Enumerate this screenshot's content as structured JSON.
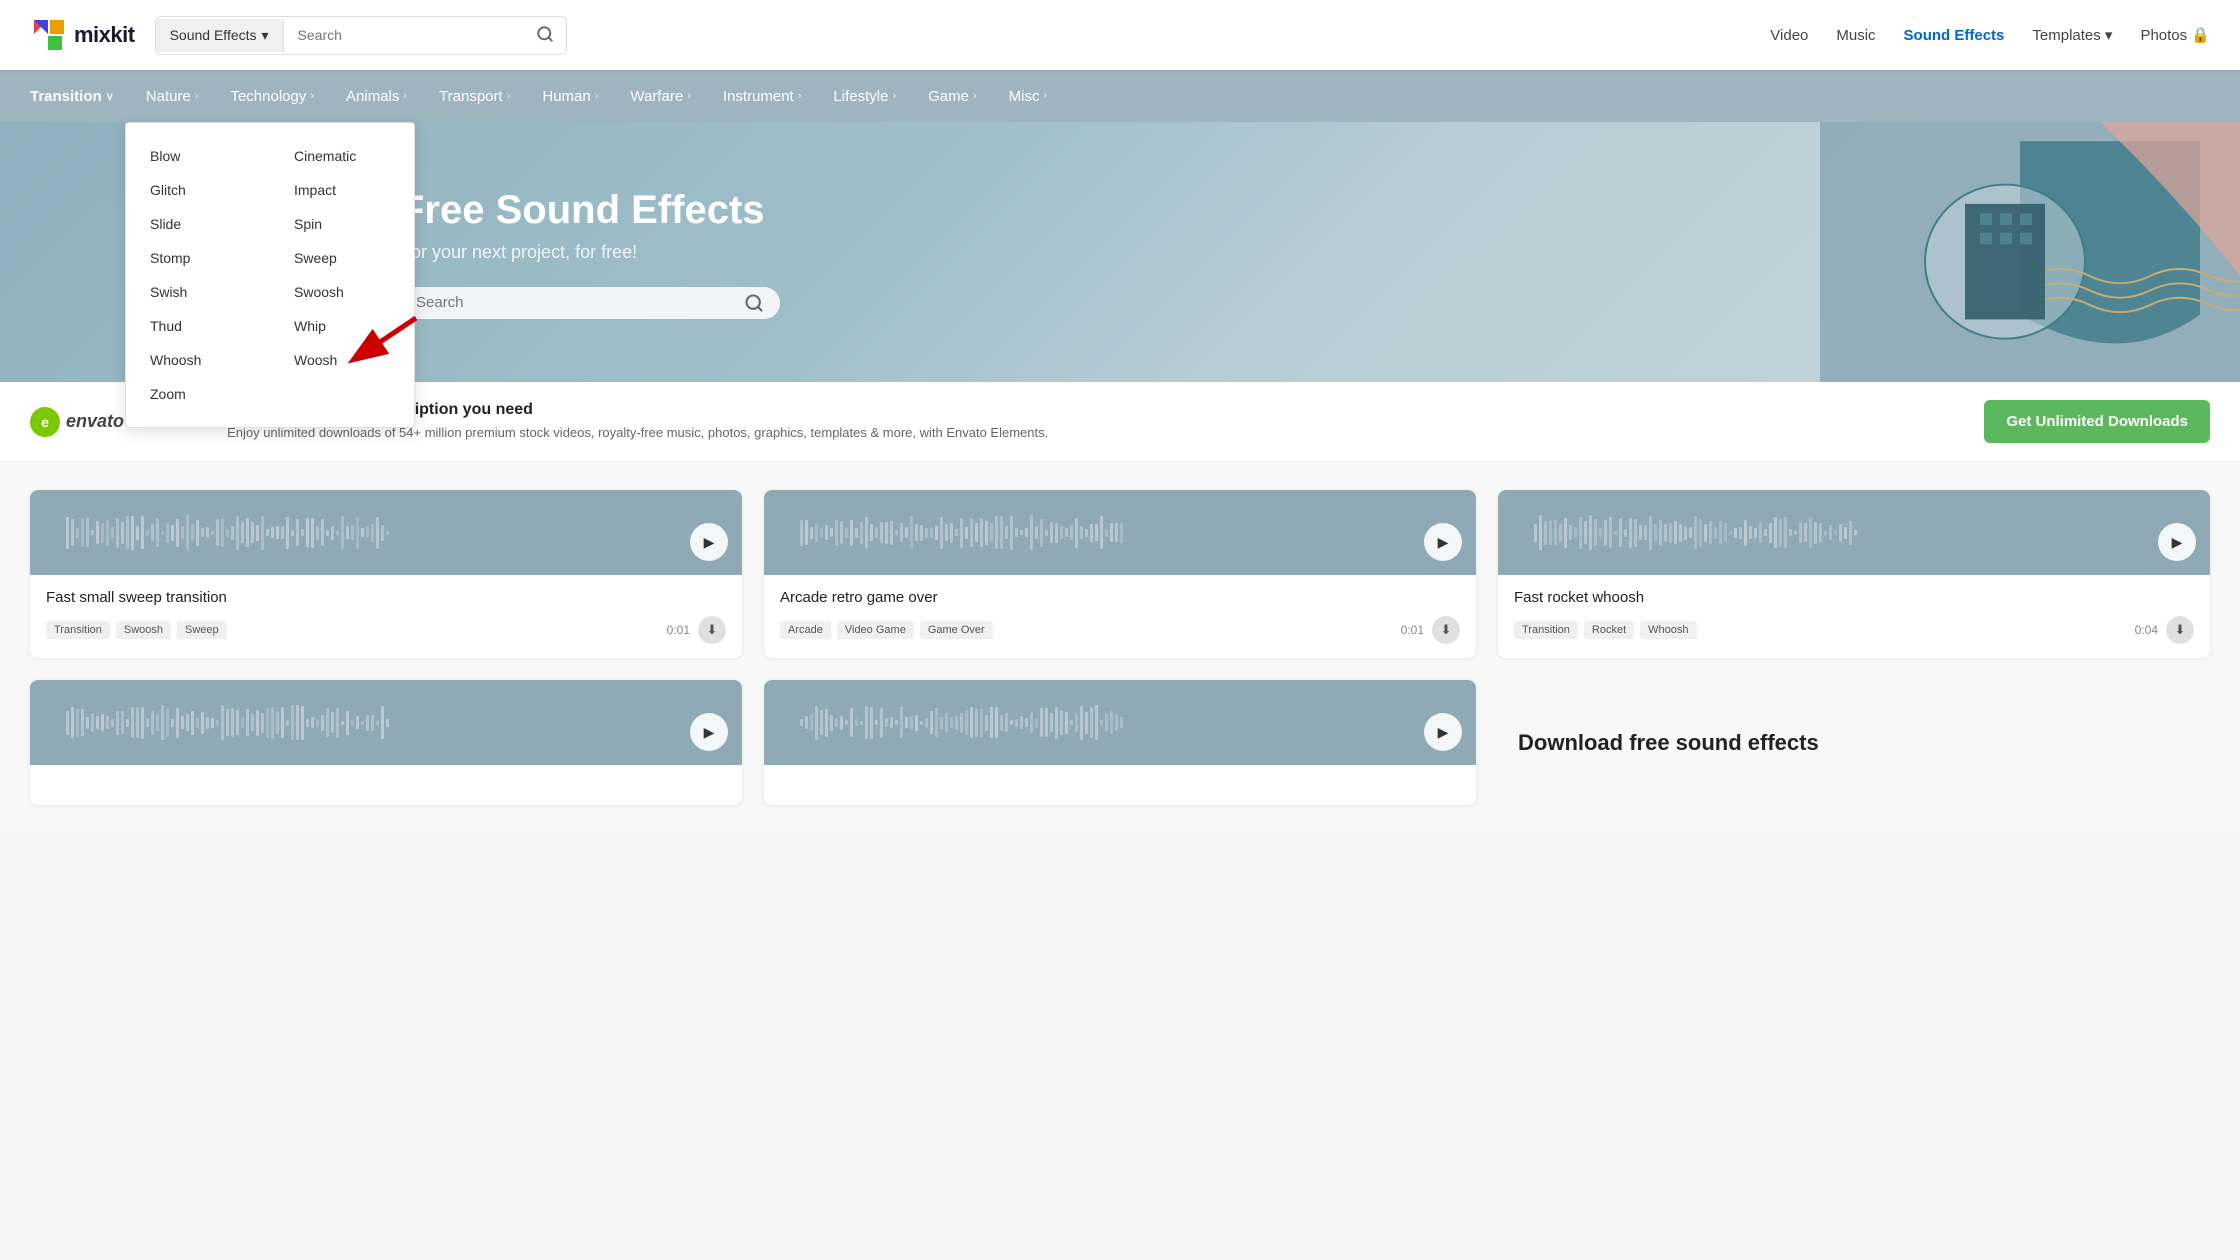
{
  "header": {
    "logo_text": "mixkit",
    "search_dropdown_label": "Sound Effects",
    "search_dropdown_chevron": "▾",
    "search_placeholder": "Search",
    "nav": [
      {
        "label": "Video",
        "active": false
      },
      {
        "label": "Music",
        "active": false
      },
      {
        "label": "Sound Effects",
        "active": true
      },
      {
        "label": "Templates",
        "active": false,
        "has_chevron": true
      },
      {
        "label": "Photos",
        "active": false,
        "has_icon": true
      }
    ]
  },
  "category_bar": {
    "items": [
      {
        "label": "Transition",
        "has_chevron": true,
        "active": true
      },
      {
        "label": "Nature",
        "has_chevron": true
      },
      {
        "label": "Technology",
        "has_chevron": true
      },
      {
        "label": "Animals",
        "has_chevron": true
      },
      {
        "label": "Transport",
        "has_chevron": true
      },
      {
        "label": "Human",
        "has_chevron": true
      },
      {
        "label": "Warfare",
        "has_chevron": true
      },
      {
        "label": "Instrument",
        "has_chevron": true
      },
      {
        "label": "Lifestyle",
        "has_chevron": true
      },
      {
        "label": "Game",
        "has_chevron": true
      },
      {
        "label": "Misc",
        "has_chevron": true
      }
    ]
  },
  "dropdown": {
    "items_col1": [
      "Blow",
      "Glitch",
      "Slide",
      "Stomp",
      "Swish",
      "Thud",
      "Whoosh",
      "Zoom"
    ],
    "items_col2": [
      "Cinematic",
      "Impact",
      "Spin",
      "Sweep",
      "Swoosh",
      "Whip",
      "Woosh"
    ]
  },
  "hero": {
    "title": "nd Effects",
    "subtitle": "oject, for free!",
    "search_placeholder": "Search"
  },
  "banner": {
    "envato_initial": "e",
    "envato_name": "envato elements",
    "title": "The only creative subscription you need",
    "desc": "Enjoy unlimited downloads of 54+ million premium stock videos, royalty-free music, photos, graphics,\ntemplates & more, with Envato Elements.",
    "cta_label": "Get Unlimited Downloads"
  },
  "sound_cards": [
    {
      "title": "Fast small sweep transition",
      "tags": [
        "Transition",
        "Swoosh",
        "Sweep"
      ],
      "duration": "0:01"
    },
    {
      "title": "Arcade retro game over",
      "tags": [
        "Arcade",
        "Video Game",
        "Game Over"
      ],
      "duration": "0:01"
    },
    {
      "title": "Fast rocket whoosh",
      "tags": [
        "Transition",
        "Rocket",
        "Whoosh"
      ],
      "duration": "0:04"
    }
  ],
  "partial_cards": [
    {
      "title": "",
      "tags": []
    },
    {
      "title": "",
      "tags": []
    }
  ],
  "download_section": {
    "title": "Download free sound effects"
  }
}
